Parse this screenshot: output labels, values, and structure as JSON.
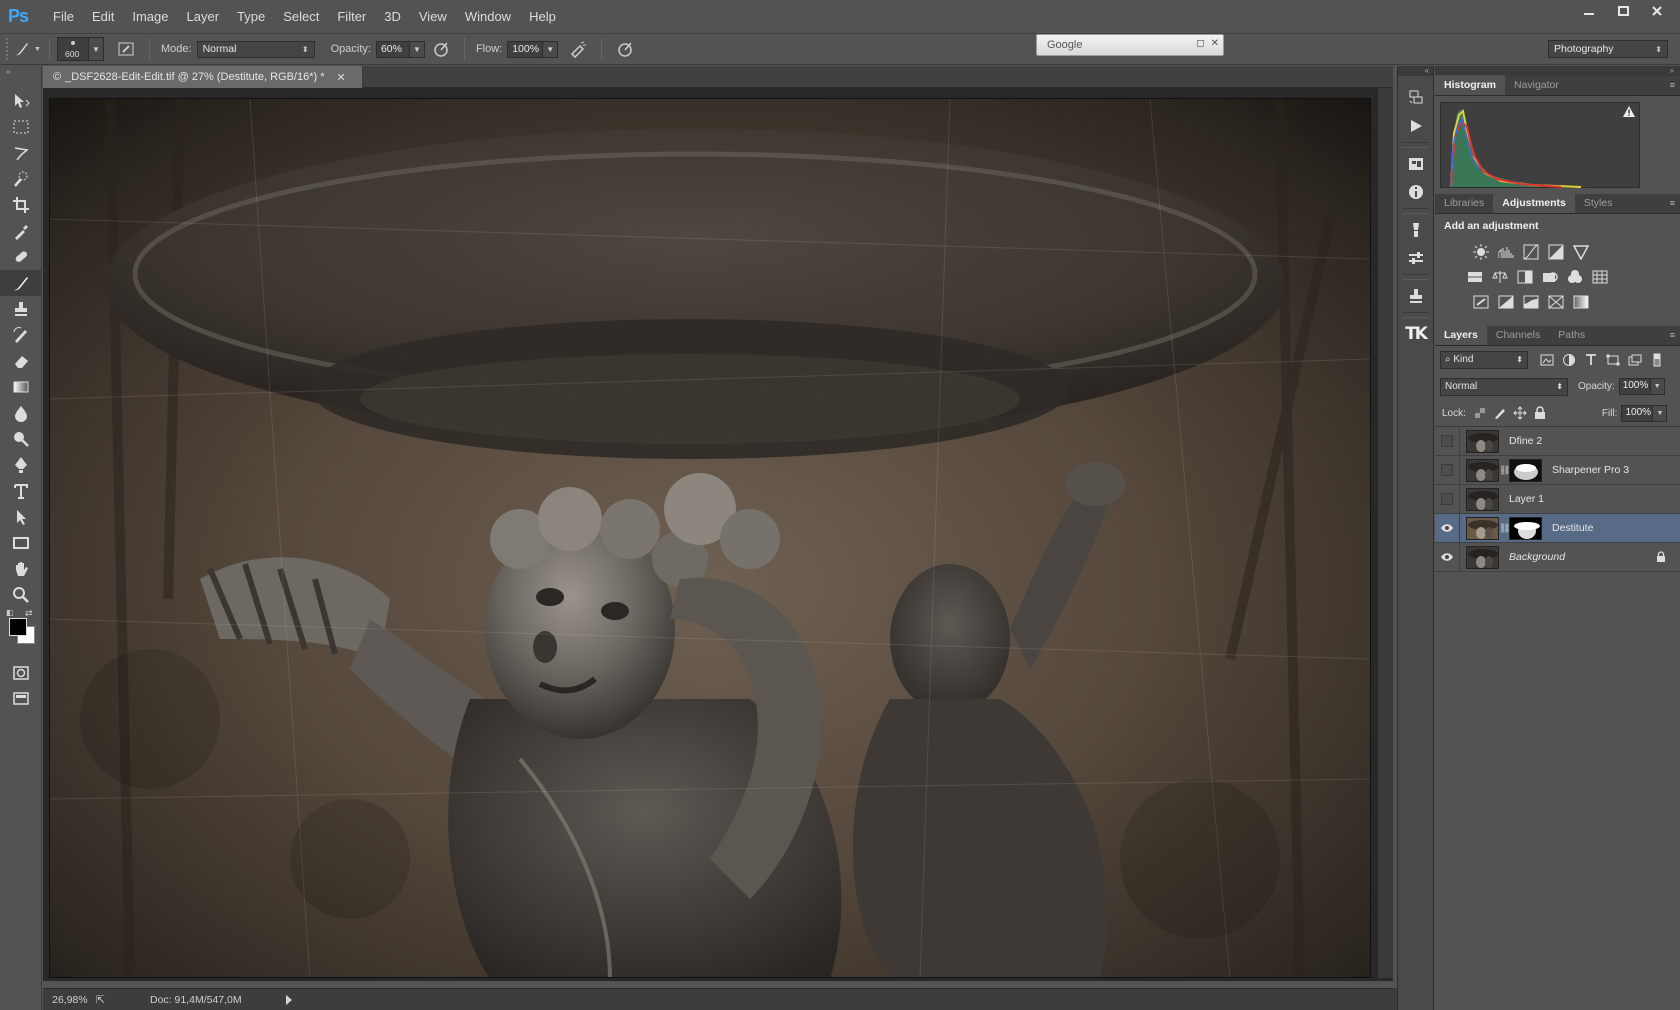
{
  "app": {
    "logo": "Ps"
  },
  "menu": [
    "File",
    "Edit",
    "Image",
    "Layer",
    "Type",
    "Select",
    "Filter",
    "3D",
    "View",
    "Window",
    "Help"
  ],
  "options": {
    "brush_size": "600",
    "mode_label": "Mode:",
    "mode_value": "Normal",
    "opacity_label": "Opacity:",
    "opacity_value": "60%",
    "flow_label": "Flow:",
    "flow_value": "100%"
  },
  "google_box": {
    "text": "Google"
  },
  "workspace": {
    "value": "Photography"
  },
  "document": {
    "tab_title": "_DSF2628-Edit-Edit.tif @ 27% (Destitute, RGB/16*) *",
    "zoom": "26,98%",
    "doc_info": "Doc: 91,4M/547,0M"
  },
  "panels": {
    "histogram_tabs": [
      "Histogram",
      "Navigator"
    ],
    "adjust_tabs": [
      "Libraries",
      "Adjustments",
      "Styles"
    ],
    "add_adjustment": "Add an adjustment",
    "layer_tabs": [
      "Layers",
      "Channels",
      "Paths"
    ],
    "kind_filter": "Kind",
    "blend_mode": "Normal",
    "opacity_label": "Opacity:",
    "opacity_value": "100%",
    "lock_label": "Lock:",
    "fill_label": "Fill:",
    "fill_value": "100%"
  },
  "layers": [
    {
      "name": "Dfine 2",
      "visible": false,
      "mask": false,
      "selected": false,
      "locked": false,
      "italic": false
    },
    {
      "name": "Sharpener Pro 3",
      "visible": false,
      "mask": true,
      "selected": false,
      "locked": false,
      "italic": false
    },
    {
      "name": "Layer 1",
      "visible": false,
      "mask": false,
      "selected": false,
      "locked": false,
      "italic": false
    },
    {
      "name": "Destitute",
      "visible": true,
      "mask": true,
      "selected": true,
      "locked": false,
      "italic": false
    },
    {
      "name": "Background",
      "visible": true,
      "mask": false,
      "selected": false,
      "locked": true,
      "italic": true
    }
  ],
  "colors": {
    "accent_blue": "#3ea6ff",
    "selected_layer": "#576a86",
    "foreground": "#000000",
    "background": "#ffffff"
  }
}
